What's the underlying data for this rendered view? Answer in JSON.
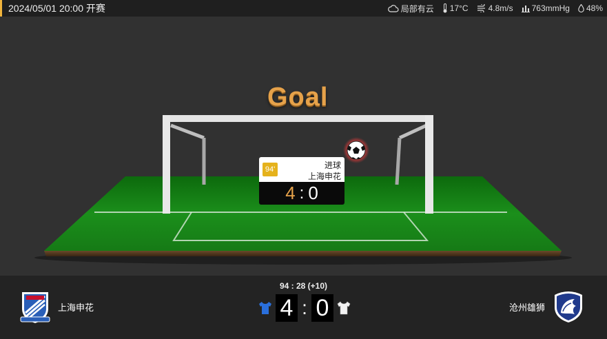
{
  "header": {
    "datetime": "2024/05/01 20:00 开赛",
    "weather": {
      "condition": "局部有云",
      "temperature": "17°C",
      "wind": "4.8m/s",
      "pressure": "763mmHg",
      "humidity": "48%"
    }
  },
  "stage": {
    "title": "Goal",
    "event": {
      "minute": "94'",
      "type": "进球",
      "team": "上海申花",
      "home_score": "4",
      "separator": ":",
      "away_score": "0"
    }
  },
  "match": {
    "clock": "94 : 28  (+10)",
    "home": {
      "name": "上海申花",
      "score": "4",
      "kit_color": "#2a6fdc"
    },
    "away": {
      "name": "沧州雄狮",
      "score": "0",
      "kit_color": "#f2f2f2"
    },
    "separator": ":"
  },
  "colors": {
    "accent": "#f0b43c",
    "goal_text": "#e6a24a",
    "pitch": "#1f8a1f",
    "badge": "#e5b21c"
  }
}
